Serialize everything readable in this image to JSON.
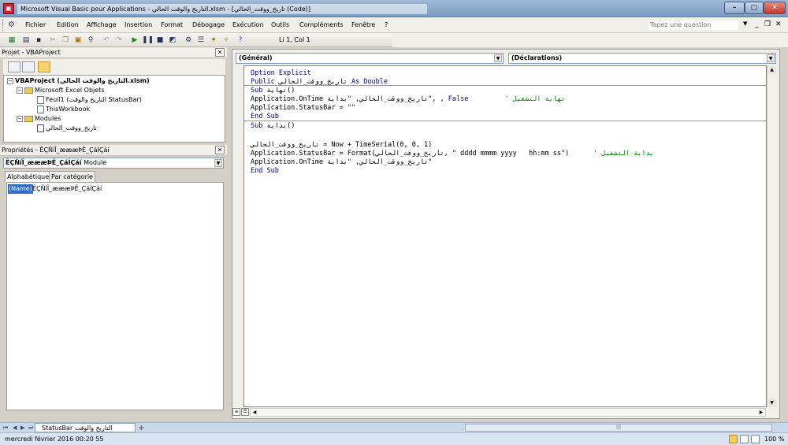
{
  "window": {
    "title": "Microsoft Visual Basic pour Applications - التاريخ والوقت الحالي.xlsm - [تاريخ_ووقت_الحالي (Code)]"
  },
  "menu": {
    "items": [
      "Fichier",
      "Edition",
      "Affichage",
      "Insertion",
      "Format",
      "Débogage",
      "Exécution",
      "Outils",
      "Compléments",
      "Fenêtre",
      "?"
    ],
    "ask_placeholder": "Tapez une question"
  },
  "toolbar": {
    "cursor_position": "Li 1, Col 1"
  },
  "project": {
    "title": "Projet - VBAProject",
    "tree": [
      {
        "label": "VBAProject (التاريخ والوقت الحالي.xlsm)",
        "bold": true
      },
      {
        "label": "Microsoft Excel Objets"
      },
      {
        "label": "Feuil1 (التاريخ والوقت StatusBar)"
      },
      {
        "label": "ThisWorkbook"
      },
      {
        "label": "Modules"
      },
      {
        "label": "تاريخ_ووقت_الحالي"
      }
    ]
  },
  "properties": {
    "title": "Propriétés - ÊÇÑíÎ_æææÞÊ_ÇáÍÇáí",
    "object_name": "ÊÇÑíÎ_æææÞÊ_ÇáÍÇáí",
    "object_type": "Module",
    "tabs": [
      "Alphabétique",
      "Par catégorie"
    ],
    "rows": [
      {
        "name": "(Name)",
        "value": "ÊÇÑíÎ_æææÞÊ_ÇáÍÇáí"
      }
    ]
  },
  "code": {
    "object_combo": "(Général)",
    "proc_combo": "(Déclarations)",
    "lines": [
      {
        "segments": [
          {
            "t": "Option Explicit",
            "c": "kw"
          }
        ]
      },
      {
        "segments": [
          {
            "t": "Public ",
            "c": "kw"
          },
          {
            "t": "تاريخ_ووقت_الحالي",
            "c": ""
          },
          {
            "t": " As Double",
            "c": "kw"
          }
        ]
      },
      {
        "segments": [
          {
            "t": "Sub ",
            "c": "kw"
          },
          {
            "t": "نهاية()",
            "c": ""
          }
        ]
      },
      {
        "segments": [
          {
            "t": "Application.OnTime ",
            "c": ""
          },
          {
            "t": "تاريخ_ووقت_الحالي",
            "c": ""
          },
          {
            "t": ", \"بداية\", , ",
            "c": ""
          },
          {
            "t": "False",
            "c": "kw"
          },
          {
            "t": "         ' نهاية التشغيل",
            "c": "cm"
          }
        ]
      },
      {
        "segments": [
          {
            "t": "Application.StatusBar = \"\"",
            "c": ""
          }
        ]
      },
      {
        "segments": [
          {
            "t": "End Sub",
            "c": "kw"
          }
        ]
      },
      {
        "segments": [
          {
            "t": "Sub ",
            "c": "kw"
          },
          {
            "t": "بداية()",
            "c": ""
          }
        ]
      },
      {
        "segments": [
          {
            "t": "",
            "c": ""
          }
        ]
      },
      {
        "segments": [
          {
            "t": "تاريخ_ووقت_الحالي",
            "c": ""
          },
          {
            "t": " = Now + TimeSerial(0, 0, 1)",
            "c": ""
          }
        ]
      },
      {
        "segments": [
          {
            "t": "Application.StatusBar = Format(",
            "c": ""
          },
          {
            "t": "تاريخ_ووقت_الحالي",
            "c": ""
          },
          {
            "t": ", \" dddd mmmm yyyy   hh:mm ss\")",
            "c": ""
          },
          {
            "t": "      ' بداية التشغيل",
            "c": "cm"
          }
        ]
      },
      {
        "segments": [
          {
            "t": "Application.OnTime ",
            "c": ""
          },
          {
            "t": "تاريخ_ووقت_الحالي",
            "c": ""
          },
          {
            "t": ", \"بداية\"",
            "c": ""
          }
        ]
      },
      {
        "segments": [
          {
            "t": "End Sub",
            "c": "kw"
          }
        ]
      }
    ]
  },
  "excel": {
    "sheet_tab": "StatusBar التاريخ والوقت",
    "status_text": "mercredi février 2016   00:20 55",
    "zoom": "100 %"
  }
}
